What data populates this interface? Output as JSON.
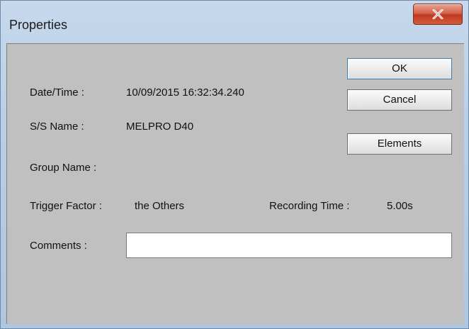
{
  "window": {
    "title": "Properties"
  },
  "fields": {
    "datetime_label": "Date/Time :",
    "datetime_value": "10/09/2015  16:32:34.240",
    "ss_name_label": "S/S Name :",
    "ss_name_value": "MELPRO D40",
    "group_name_label": "Group Name :",
    "group_name_value": "",
    "trigger_label": "Trigger Factor :",
    "trigger_value": "the Others",
    "recording_label": "Recording Time :",
    "recording_value": "5.00s",
    "comments_label": "Comments :",
    "comments_value": ""
  },
  "buttons": {
    "ok_label": "OK",
    "cancel_label": "Cancel",
    "elements_label": "Elements"
  },
  "icons": {
    "close": "close-icon"
  },
  "colors": {
    "client_bg": "#c0c0c0",
    "close_button": "#c0391f",
    "default_button_border": "#3c7fb1"
  }
}
